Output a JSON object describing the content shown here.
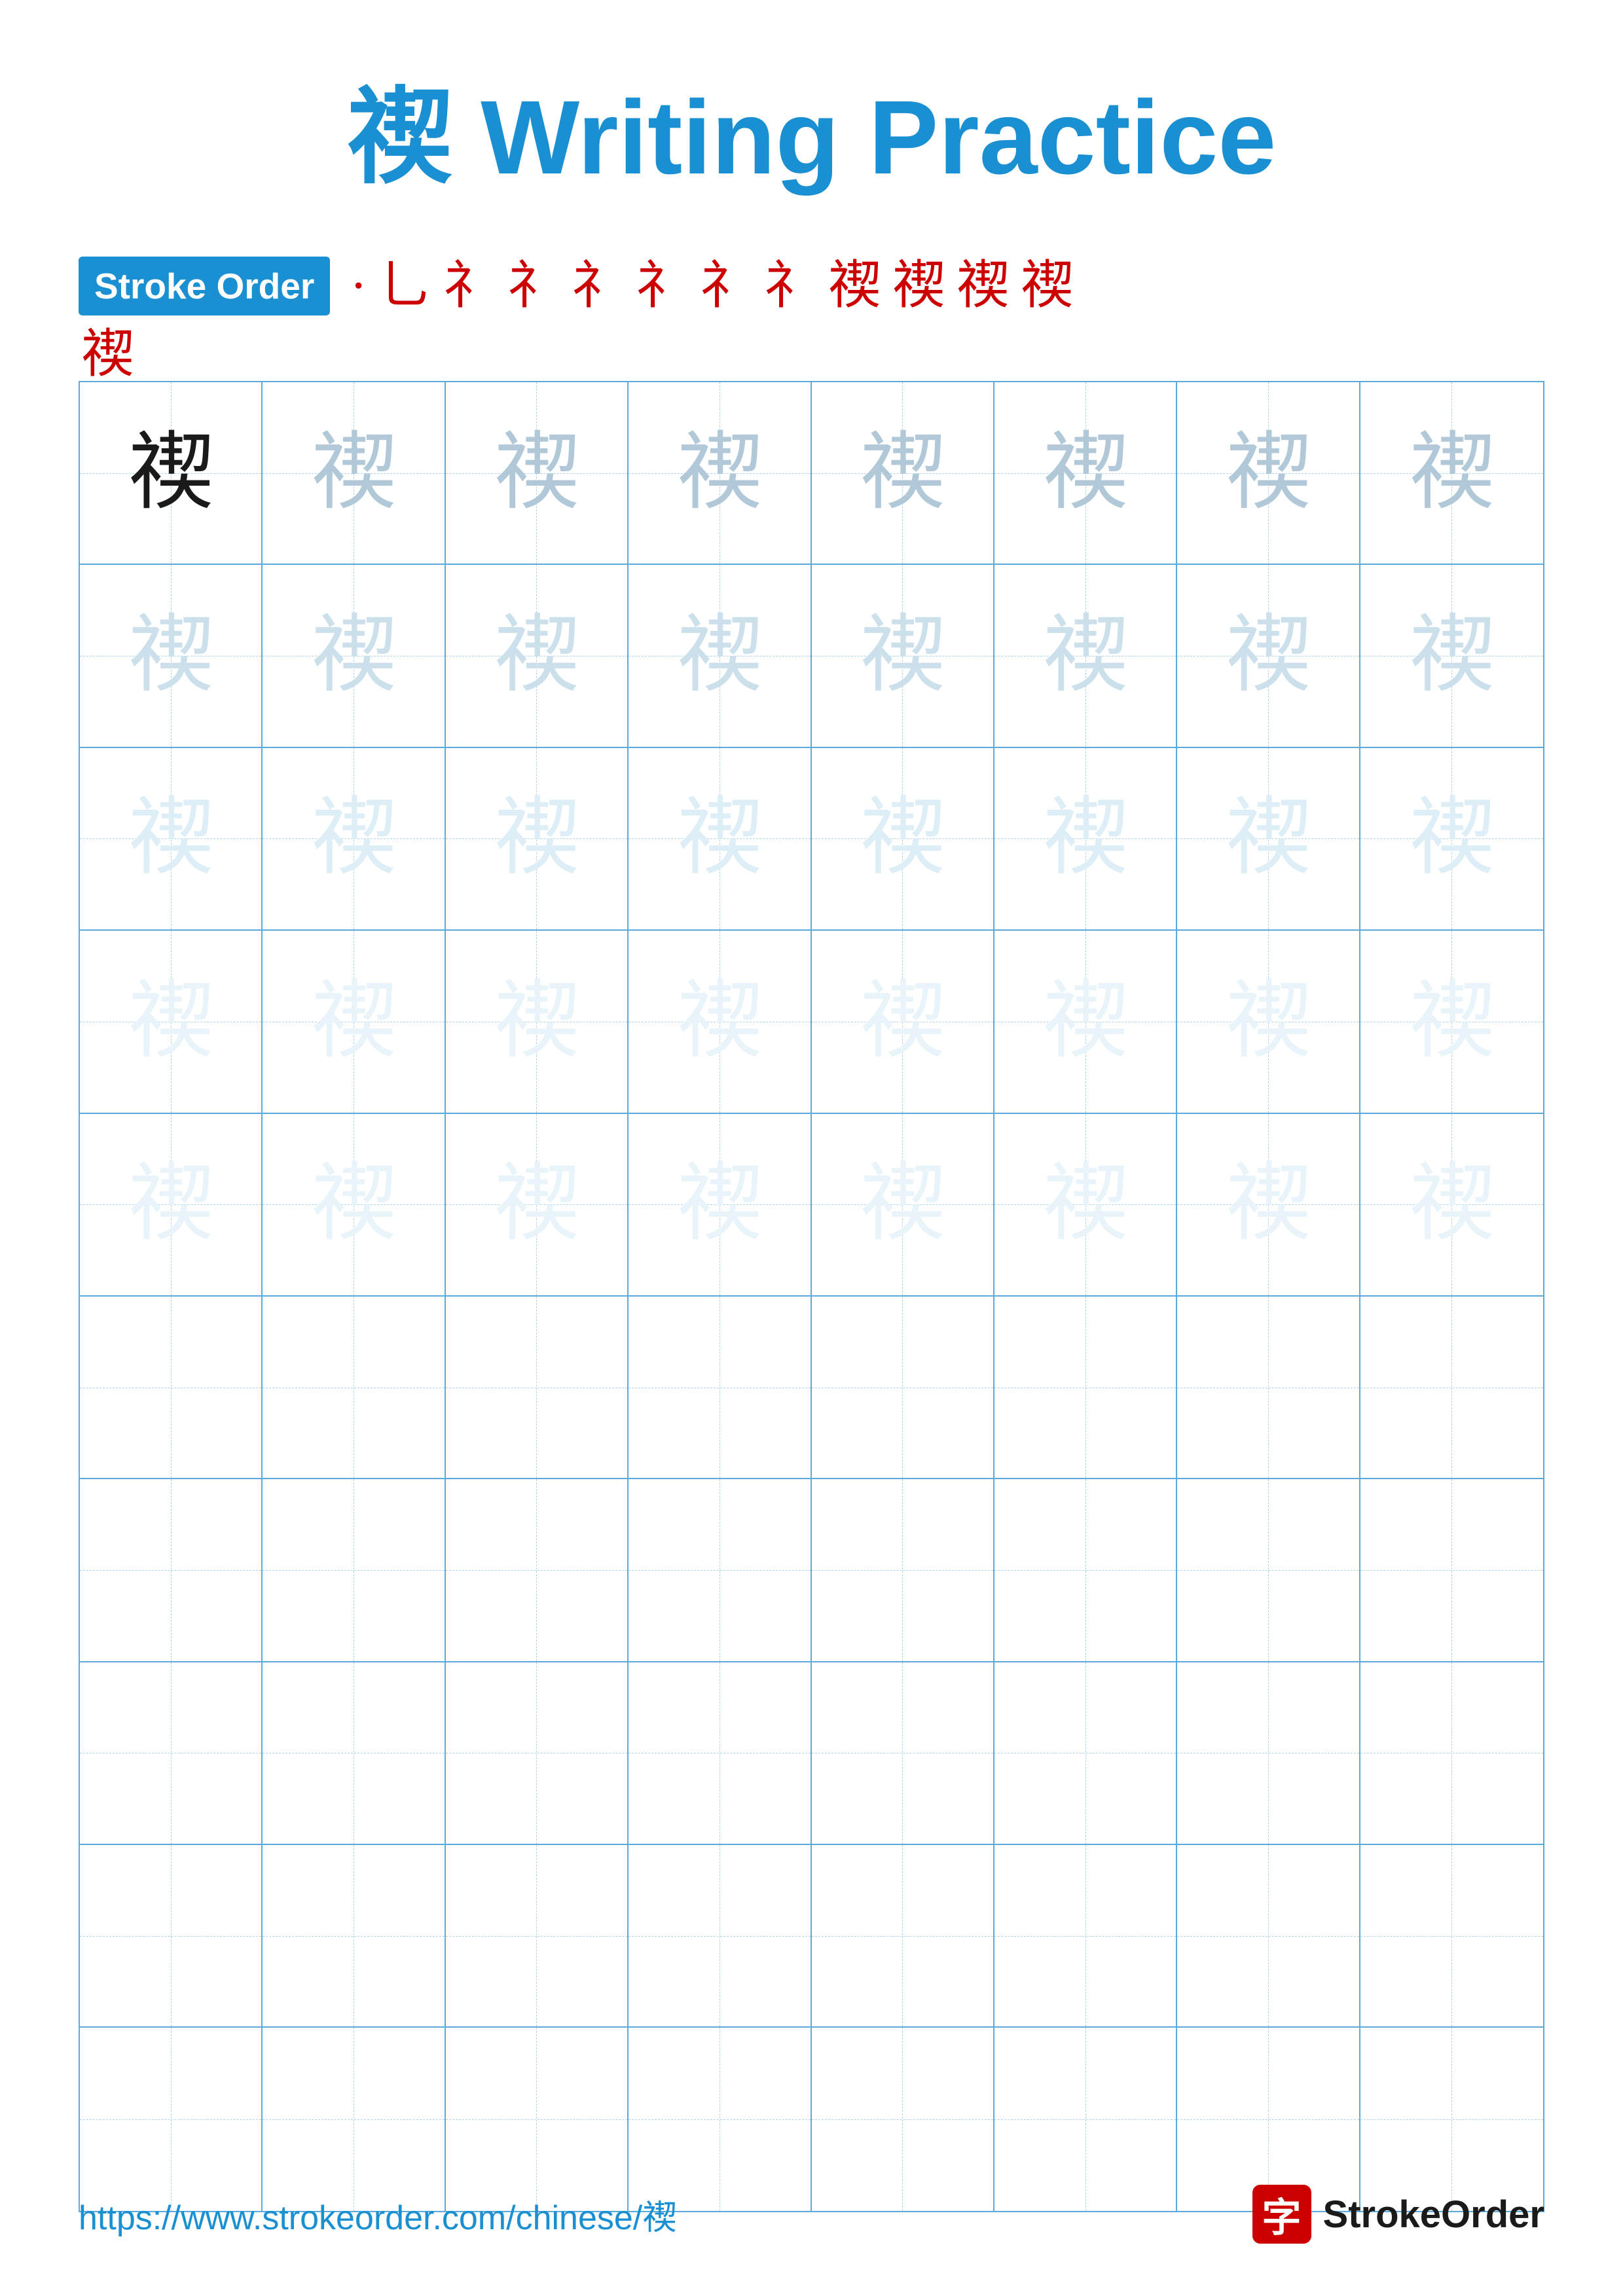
{
  "title": {
    "char": "禊",
    "text": " Writing Practice"
  },
  "stroke_order": {
    "badge_label": "Stroke Order",
    "strokes": [
      "·",
      "⺃",
      "礻",
      "礻",
      "礻",
      "礻",
      "礻",
      "礻",
      "禊",
      "禊",
      "禊",
      "禊"
    ],
    "overflow_char": "禊"
  },
  "grid": {
    "char": "禊",
    "rows": 10,
    "cols": 8,
    "filled_rows": 5,
    "shading": [
      [
        "dark",
        "medium",
        "medium",
        "medium",
        "medium",
        "medium",
        "medium",
        "medium"
      ],
      [
        "light",
        "light",
        "light",
        "light",
        "light",
        "light",
        "light",
        "light"
      ],
      [
        "lighter",
        "lighter",
        "lighter",
        "lighter",
        "lighter",
        "lighter",
        "lighter",
        "lighter"
      ],
      [
        "lightest",
        "lightest",
        "lightest",
        "lightest",
        "lightest",
        "lightest",
        "lightest",
        "lightest"
      ],
      [
        "lightest",
        "lightest",
        "lightest",
        "lightest",
        "lightest",
        "lightest",
        "lightest",
        "lightest"
      ]
    ]
  },
  "footer": {
    "url": "https://www.strokeorder.com/chinese/禊",
    "brand_char": "字",
    "brand_name": "StrokeOrder"
  }
}
